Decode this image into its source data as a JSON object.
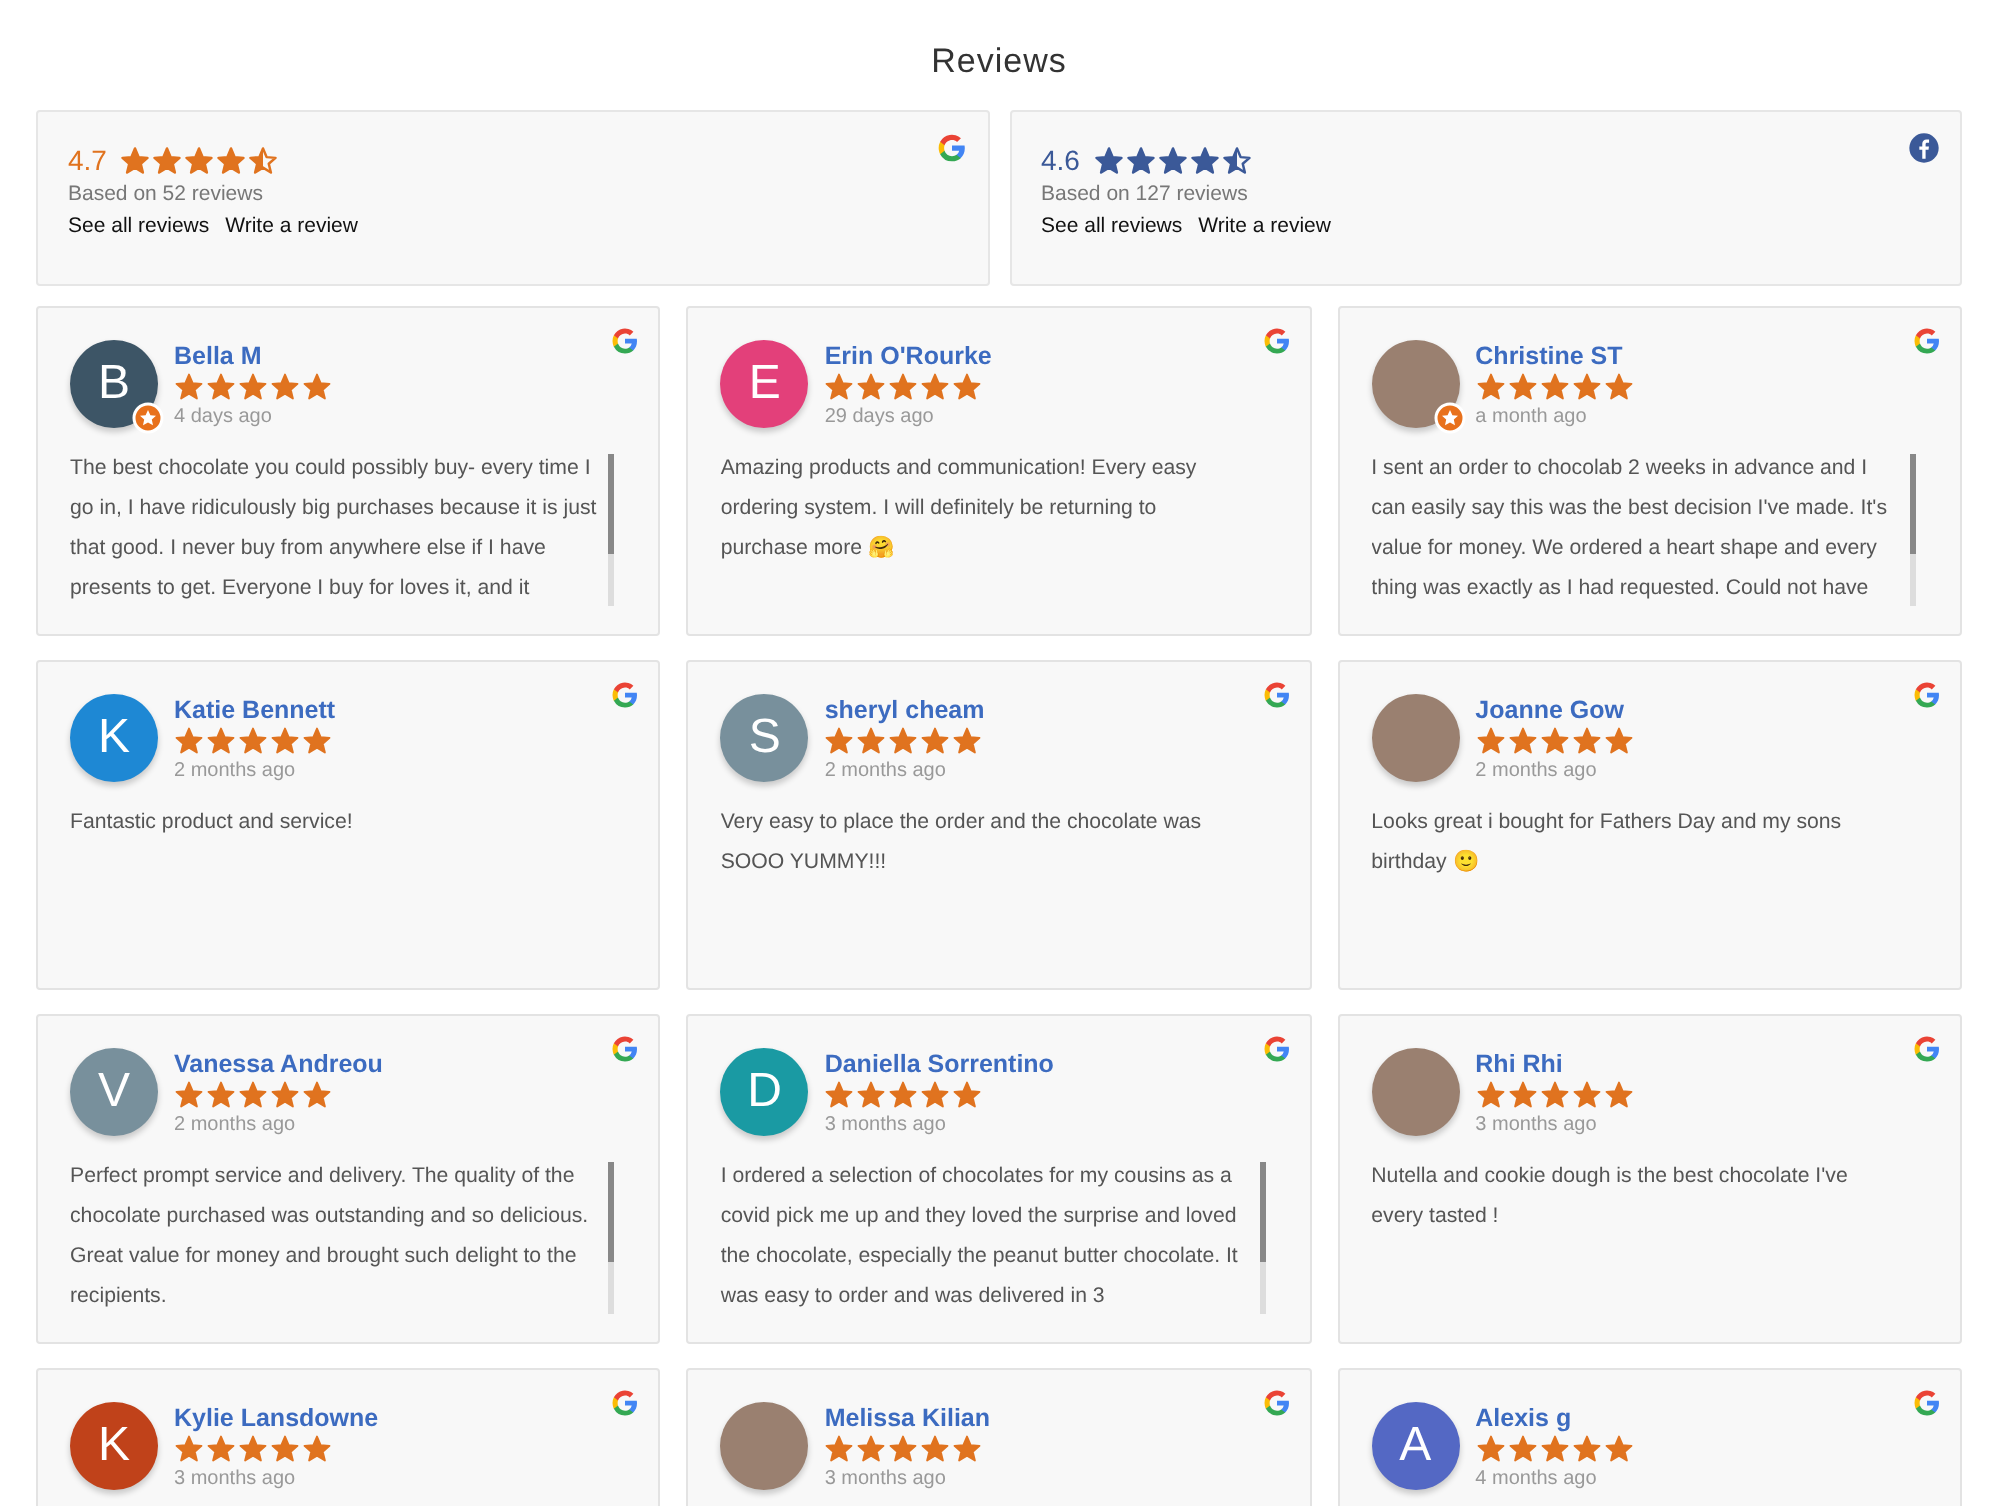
{
  "title": "Reviews",
  "summaries": [
    {
      "kind": "google",
      "rating": "4.7",
      "stars": 4.5,
      "based_on": "Based on 52 reviews",
      "links": [
        "See all reviews",
        "Write a review"
      ]
    },
    {
      "kind": "facebook",
      "rating": "4.6",
      "stars": 4.5,
      "based_on": "Based on 127 reviews",
      "links": [
        "See all reviews",
        "Write a review"
      ]
    }
  ],
  "reviews": [
    {
      "name": "Bella M",
      "avatar": {
        "kind": "letter",
        "letter": "B",
        "color": "#3d5566"
      },
      "badge": true,
      "stars": 5,
      "time": "4 days ago",
      "kind": "google",
      "scrollable": true,
      "text": "The best chocolate you could possibly buy- every time I go in, I have ridiculously big purchases because it is just that good. I never buy from anywhere else if I have presents to get. Everyone I buy for loves it, and it"
    },
    {
      "name": "Erin O'Rourke",
      "avatar": {
        "kind": "letter",
        "letter": "E",
        "color": "#e3407a"
      },
      "badge": false,
      "stars": 5,
      "time": "29 days ago",
      "kind": "google",
      "scrollable": false,
      "text": "Amazing products and communication! Every easy ordering system. I will definitely be returning to purchase more 🤗"
    },
    {
      "name": "Christine ST",
      "avatar": {
        "kind": "photo"
      },
      "badge": true,
      "stars": 5,
      "time": "a month ago",
      "kind": "google",
      "scrollable": true,
      "text": "I sent an order to chocolab 2 weeks in advance and I can easily say this was the best decision I've made. It's value for money. We ordered a heart shape and every thing was exactly as I had requested. Could not have"
    },
    {
      "name": "Katie Bennett",
      "avatar": {
        "kind": "letter",
        "letter": "K",
        "color": "#1e88d4"
      },
      "badge": false,
      "stars": 5,
      "time": "2 months ago",
      "kind": "google",
      "scrollable": false,
      "text": "Fantastic product and service!"
    },
    {
      "name": "sheryl cheam",
      "avatar": {
        "kind": "letter",
        "letter": "S",
        "color": "#78909c"
      },
      "badge": false,
      "stars": 5,
      "time": "2 months ago",
      "kind": "google",
      "scrollable": false,
      "text": "Very easy to place the order and the chocolate was SOOO YUMMY!!!"
    },
    {
      "name": "Joanne Gow",
      "avatar": {
        "kind": "photo"
      },
      "badge": false,
      "stars": 5,
      "time": "2 months ago",
      "kind": "google",
      "scrollable": false,
      "text": "Looks great i bought for Fathers Day and my sons birthday 🙂"
    },
    {
      "name": "Vanessa Andreou",
      "avatar": {
        "kind": "letter",
        "letter": "V",
        "color": "#78909c"
      },
      "badge": false,
      "stars": 5,
      "time": "2 months ago",
      "kind": "google",
      "scrollable": true,
      "text": "Perfect prompt service and delivery. The quality of the chocolate purchased was outstanding and so delicious. Great value for money and brought such delight to the recipients."
    },
    {
      "name": "Daniella Sorrentino",
      "avatar": {
        "kind": "letter",
        "letter": "D",
        "color": "#1a9aa3"
      },
      "badge": false,
      "stars": 5,
      "time": "3 months ago",
      "kind": "google",
      "scrollable": true,
      "text": "I ordered a selection of chocolates for my cousins as a covid pick me up and they loved the surprise and loved the chocolate, especially the peanut butter chocolate. It was easy to order and was delivered in 3"
    },
    {
      "name": "Rhi Rhi",
      "avatar": {
        "kind": "photo"
      },
      "badge": false,
      "stars": 5,
      "time": "3 months ago",
      "kind": "google",
      "scrollable": false,
      "text": "Nutella and cookie dough is the best chocolate I've every tasted !"
    },
    {
      "name": "Kylie Lansdowne",
      "avatar": {
        "kind": "letter",
        "letter": "K",
        "color": "#c0421a"
      },
      "badge": false,
      "stars": 5,
      "time": "3 months ago",
      "kind": "google",
      "scrollable": false
    },
    {
      "name": "Melissa Kilian",
      "avatar": {
        "kind": "photo"
      },
      "badge": false,
      "stars": 5,
      "time": "3 months ago",
      "kind": "google",
      "scrollable": false
    },
    {
      "name": "Alexis g",
      "avatar": {
        "kind": "letter",
        "letter": "A",
        "color": "#5468c4"
      },
      "badge": false,
      "stars": 5,
      "time": "4 months ago",
      "kind": "google",
      "scrollable": false
    }
  ]
}
